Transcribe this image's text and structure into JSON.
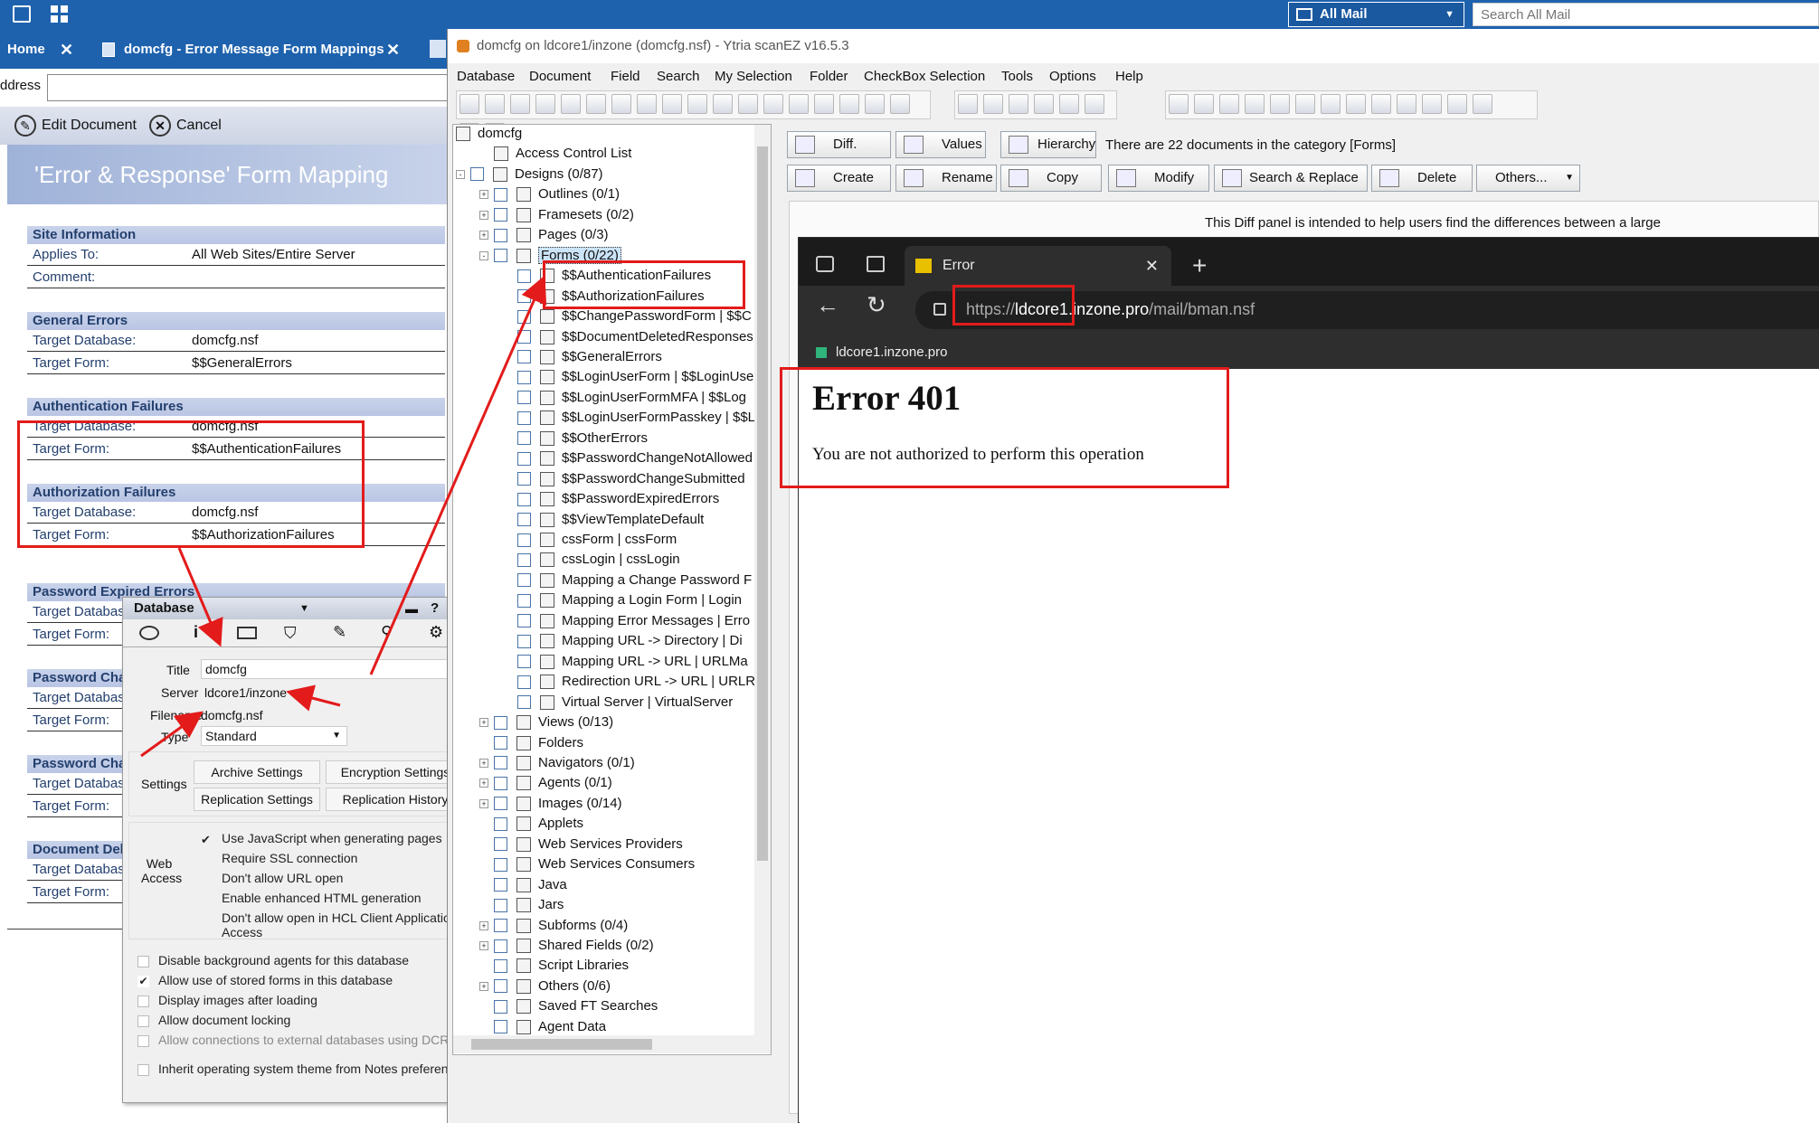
{
  "notes": {
    "topbar": {
      "mail_selector": "All Mail",
      "search_placeholder": "Search All Mail"
    },
    "tabs": [
      {
        "label": "Home"
      },
      {
        "label": "domcfg - Error Message Form Mappings"
      }
    ],
    "address_label": "ddress",
    "actions": {
      "edit": "Edit Document",
      "cancel": "Cancel"
    },
    "form_title": "'Error & Response' Form Mapping",
    "sections": [
      {
        "title": "Site Information",
        "fields": [
          {
            "label": "Applies To:",
            "value": "All Web Sites/Entire Server"
          },
          {
            "label": "Comment:",
            "value": ""
          }
        ]
      },
      {
        "title": "General Errors",
        "fields": [
          {
            "label": "Target Database:",
            "value": "domcfg.nsf"
          },
          {
            "label": "Target Form:",
            "value": "$$GeneralErrors"
          }
        ]
      },
      {
        "title": "Authentication Failures",
        "fields": [
          {
            "label": "Target Database:",
            "value": "domcfg.nsf"
          },
          {
            "label": "Target Form:",
            "value": "$$AuthenticationFailures"
          }
        ]
      },
      {
        "title": "Authorization Failures",
        "fields": [
          {
            "label": "Target Database:",
            "value": "domcfg.nsf"
          },
          {
            "label": "Target Form:",
            "value": "$$AuthorizationFailures"
          }
        ]
      },
      {
        "title": "Password Expired Errors",
        "fields": [
          {
            "label": "Target Database:",
            "value": ""
          },
          {
            "label": "Target Form:",
            "value": ""
          }
        ]
      },
      {
        "title": "Password Change",
        "fields": [
          {
            "label": "Target Database:",
            "value": ""
          },
          {
            "label": "Target Form:",
            "value": ""
          }
        ]
      },
      {
        "title": "Password Change",
        "fields": [
          {
            "label": "Target Database:",
            "value": ""
          },
          {
            "label": "Target Form:",
            "value": ""
          }
        ]
      },
      {
        "title": "Document Deleted",
        "fields": [
          {
            "label": "Target Database:",
            "value": ""
          },
          {
            "label": "Target Form:",
            "value": ""
          }
        ]
      }
    ]
  },
  "props": {
    "header": "Database",
    "title_label": "Title",
    "title_value": "domcfg",
    "server_label": "Server",
    "server_value": "ldcore1/inzone",
    "filename_label": "Filename",
    "filename_value": "domcfg.nsf",
    "type_label": "Type",
    "type_value": "Standard",
    "settings_label": "Settings",
    "buttons": [
      "Archive Settings",
      "Encryption Settings",
      "Replication Settings",
      "Replication History"
    ],
    "web_access_label": "Web Access",
    "web_options": [
      {
        "label": "Use JavaScript when generating pages",
        "checked": true
      },
      {
        "label": "Require SSL connection",
        "checked": false
      },
      {
        "label": "Don't allow URL open",
        "checked": false
      },
      {
        "label": "Enable enhanced HTML generation",
        "checked": false
      },
      {
        "label": "Don't allow open in HCL Client Application Access",
        "checked": false
      }
    ],
    "db_options": [
      {
        "label": "Disable background agents for this database",
        "checked": false
      },
      {
        "label": "Allow use of stored forms in this database",
        "checked": true
      },
      {
        "label": "Display images after loading",
        "checked": false
      },
      {
        "label": "Allow document locking",
        "checked": false
      },
      {
        "label": "Allow connections to external databases using DCRs",
        "checked": false
      },
      {
        "label": "Inherit operating system theme from Notes preferences",
        "checked": false
      }
    ]
  },
  "scanez": {
    "title": "domcfg on ldcore1/inzone (domcfg.nsf) - Ytria scanEZ v16.5.3",
    "menu": [
      "Database",
      "Document",
      "Field",
      "Search",
      "My Selection",
      "Folder",
      "CheckBox Selection",
      "Tools",
      "Options",
      "Help"
    ],
    "tree": [
      {
        "label": "domcfg",
        "level": 0,
        "checkbox": false,
        "expander": ""
      },
      {
        "label": "Access Control List",
        "level": 1,
        "checkbox": false,
        "expander": ""
      },
      {
        "label": "Designs  (0/87)",
        "level": 0,
        "checkbox": true,
        "expander": "-"
      },
      {
        "label": "Outlines  (0/1)",
        "level": 1,
        "checkbox": true,
        "expander": "+"
      },
      {
        "label": "Framesets  (0/2)",
        "level": 1,
        "checkbox": true,
        "expander": "+"
      },
      {
        "label": "Pages  (0/3)",
        "level": 1,
        "checkbox": true,
        "expander": "+"
      },
      {
        "label": "Forms  (0/22)",
        "level": 1,
        "checkbox": true,
        "expander": "-",
        "selected": true
      },
      {
        "label": "$$AuthenticationFailures",
        "level": 2,
        "checkbox": true,
        "expander": ""
      },
      {
        "label": "$$AuthorizationFailures",
        "level": 2,
        "checkbox": true,
        "expander": ""
      },
      {
        "label": "$$ChangePasswordForm  | $$C",
        "level": 2,
        "checkbox": true,
        "expander": ""
      },
      {
        "label": "$$DocumentDeletedResponses",
        "level": 2,
        "checkbox": true,
        "expander": ""
      },
      {
        "label": "$$GeneralErrors",
        "level": 2,
        "checkbox": true,
        "expander": ""
      },
      {
        "label": "$$LoginUserForm  | $$LoginUse",
        "level": 2,
        "checkbox": true,
        "expander": ""
      },
      {
        "label": "$$LoginUserFormMFA  | $$Log",
        "level": 2,
        "checkbox": true,
        "expander": ""
      },
      {
        "label": "$$LoginUserFormPasskey  | $$L",
        "level": 2,
        "checkbox": true,
        "expander": ""
      },
      {
        "label": "$$OtherErrors",
        "level": 2,
        "checkbox": true,
        "expander": ""
      },
      {
        "label": "$$PasswordChangeNotAllowed",
        "level": 2,
        "checkbox": true,
        "expander": ""
      },
      {
        "label": "$$PasswordChangeSubmitted",
        "level": 2,
        "checkbox": true,
        "expander": ""
      },
      {
        "label": "$$PasswordExpiredErrors",
        "level": 2,
        "checkbox": true,
        "expander": ""
      },
      {
        "label": "$$ViewTemplateDefault",
        "level": 2,
        "checkbox": true,
        "expander": ""
      },
      {
        "label": "cssForm  | cssForm",
        "level": 2,
        "checkbox": true,
        "expander": ""
      },
      {
        "label": "cssLogin  | cssLogin",
        "level": 2,
        "checkbox": true,
        "expander": ""
      },
      {
        "label": "Mapping a Change Password F",
        "level": 2,
        "checkbox": true,
        "expander": ""
      },
      {
        "label": "Mapping a Login Form  | Login",
        "level": 2,
        "checkbox": true,
        "expander": ""
      },
      {
        "label": "Mapping Error Messages  | Erro",
        "level": 2,
        "checkbox": true,
        "expander": ""
      },
      {
        "label": "Mapping URL -> Directory  | Di",
        "level": 2,
        "checkbox": true,
        "expander": ""
      },
      {
        "label": "Mapping URL -> URL  | URLMa",
        "level": 2,
        "checkbox": true,
        "expander": ""
      },
      {
        "label": "Redirection URL -> URL  | URLR",
        "level": 2,
        "checkbox": true,
        "expander": ""
      },
      {
        "label": "Virtual Server  | VirtualServer",
        "level": 2,
        "checkbox": true,
        "expander": ""
      },
      {
        "label": "Views  (0/13)",
        "level": 1,
        "checkbox": true,
        "expander": "+"
      },
      {
        "label": "Folders",
        "level": 1,
        "checkbox": true,
        "expander": ""
      },
      {
        "label": "Navigators  (0/1)",
        "level": 1,
        "checkbox": true,
        "expander": "+"
      },
      {
        "label": "Agents  (0/1)",
        "level": 1,
        "checkbox": true,
        "expander": "+"
      },
      {
        "label": "Images  (0/14)",
        "level": 1,
        "checkbox": true,
        "expander": "+"
      },
      {
        "label": "Applets",
        "level": 1,
        "checkbox": true,
        "expander": ""
      },
      {
        "label": "Web Services Providers",
        "level": 1,
        "checkbox": true,
        "expander": ""
      },
      {
        "label": "Web Services Consumers",
        "level": 1,
        "checkbox": true,
        "expander": ""
      },
      {
        "label": "Java",
        "level": 1,
        "checkbox": true,
        "expander": ""
      },
      {
        "label": "Jars",
        "level": 1,
        "checkbox": true,
        "expander": ""
      },
      {
        "label": "Subforms  (0/4)",
        "level": 1,
        "checkbox": true,
        "expander": "+"
      },
      {
        "label": "Shared Fields  (0/2)",
        "level": 1,
        "checkbox": true,
        "expander": "+"
      },
      {
        "label": "Script Libraries",
        "level": 1,
        "checkbox": true,
        "expander": ""
      },
      {
        "label": "Others  (0/6)",
        "level": 1,
        "checkbox": true,
        "expander": "+"
      },
      {
        "label": "Saved FT Searches",
        "level": 1,
        "checkbox": true,
        "expander": ""
      },
      {
        "label": "Agent Data",
        "level": 1,
        "checkbox": true,
        "expander": ""
      }
    ],
    "action_buttons_row1": [
      "Diff.",
      "Values",
      "Hierarchy"
    ],
    "status_text": "There are 22 documents in the category [Forms]",
    "action_buttons_row2": [
      "Create",
      "Rename",
      "Copy",
      "Modify",
      "Search & Replace",
      "Delete",
      "Others..."
    ],
    "diff_text": "This Diff panel is intended to help users find the differences between a large"
  },
  "browser": {
    "tab_title": "Error",
    "url_prefix": "https://",
    "url_host": "ldcore1.inzone.pro",
    "url_path": "/mail/bman.nsf",
    "bookmark": "ldcore1.inzone.pro",
    "heading": "Error 401",
    "message": "You are not authorized to perform this operation"
  },
  "colors": {
    "accent": "#1e62ae",
    "highlight": "#e31b1b",
    "browser_dark": "#202020",
    "section_head": "#c9d3ea"
  }
}
